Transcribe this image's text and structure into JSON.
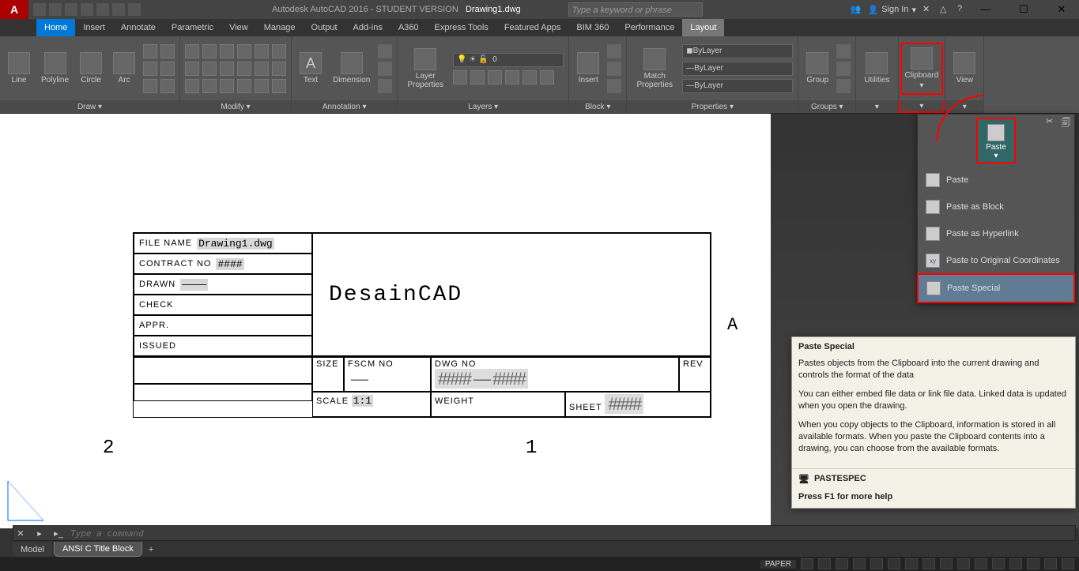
{
  "title": {
    "app": "Autodesk AutoCAD 2016 - STUDENT VERSION",
    "file": "Drawing1.dwg"
  },
  "search_placeholder": "Type a keyword or phrase",
  "signin": "Sign In",
  "tabs": [
    "Home",
    "Insert",
    "Annotate",
    "Parametric",
    "View",
    "Manage",
    "Output",
    "Add-ins",
    "A360",
    "Express Tools",
    "Featured Apps",
    "BIM 360",
    "Performance",
    "Layout"
  ],
  "active_tab": "Home",
  "hl_tab": "Layout",
  "ribbon": {
    "draw": {
      "label": "Draw ▾",
      "tools": [
        "Line",
        "Polyline",
        "Circle",
        "Arc"
      ]
    },
    "modify": {
      "label": "Modify ▾"
    },
    "annotation": {
      "label": "Annotation ▾",
      "tools": [
        "Text",
        "Dimension"
      ]
    },
    "layers": {
      "label": "Layers ▾",
      "tool": "Layer Properties",
      "sel": "0"
    },
    "block": {
      "label": "Block ▾",
      "tool": "Insert"
    },
    "props": {
      "label": "Properties ▾",
      "tool": "Match Properties",
      "v1": "ByLayer",
      "v2": "ByLayer",
      "v3": "ByLayer"
    },
    "groups": {
      "label": "Groups ▾",
      "tool": "Group"
    },
    "utilities": {
      "label": "Utilities",
      "dd": "▾"
    },
    "clipboard": {
      "label": "Clipboard",
      "dd": "▾"
    },
    "view": {
      "label": "View",
      "dd": "▾"
    }
  },
  "paste_btn": "Paste",
  "flyout": {
    "items": [
      {
        "label": "Paste"
      },
      {
        "label": "Paste as Block"
      },
      {
        "label": "Paste as Hyperlink"
      },
      {
        "label": "Paste to Original Coordinates"
      },
      {
        "label": "Paste Special"
      }
    ]
  },
  "tooltip": {
    "title": "Paste Special",
    "p1": "Pastes objects from the Clipboard into the current drawing and controls the format of the data",
    "p2": "You can either embed file data or link file data. Linked data is updated when you open the drawing.",
    "p3": "When you copy objects to the Clipboard, information is stored in all available formats. When you paste the Clipboard contents into a drawing, you can choose from the available formats.",
    "cmd": "PASTESPEC",
    "help": "Press F1 for more help"
  },
  "titleblock": {
    "file_lbl": "FILE NAME",
    "file_val": "Drawing1.dwg",
    "contract_lbl": "CONTRACT NO",
    "contract_val": "####",
    "drawn_lbl": "DRAWN",
    "drawn_val": "————",
    "check_lbl": "CHECK",
    "appr_lbl": "APPR.",
    "issued_lbl": "ISSUED",
    "main": "DesainCAD",
    "size_lbl": "SIZE",
    "fscm_lbl": "FSCM NO",
    "dwg_lbl": "DWG NO",
    "rev_lbl": "REV",
    "fscm_val": "—",
    "dwg_val": "####  —  ####",
    "scale_lbl": "SCALE",
    "scale_val": "1:1",
    "weight_lbl": "WEIGHT",
    "sheet_lbl": "SHEET",
    "sheet_val": "####"
  },
  "axes": {
    "a": "A",
    "two": "2",
    "one": "1"
  },
  "cmd_placeholder": "Type a command",
  "btabs": {
    "model": "Model",
    "layout": "ANSI C Title Block"
  },
  "status": {
    "paper": "PAPER"
  }
}
